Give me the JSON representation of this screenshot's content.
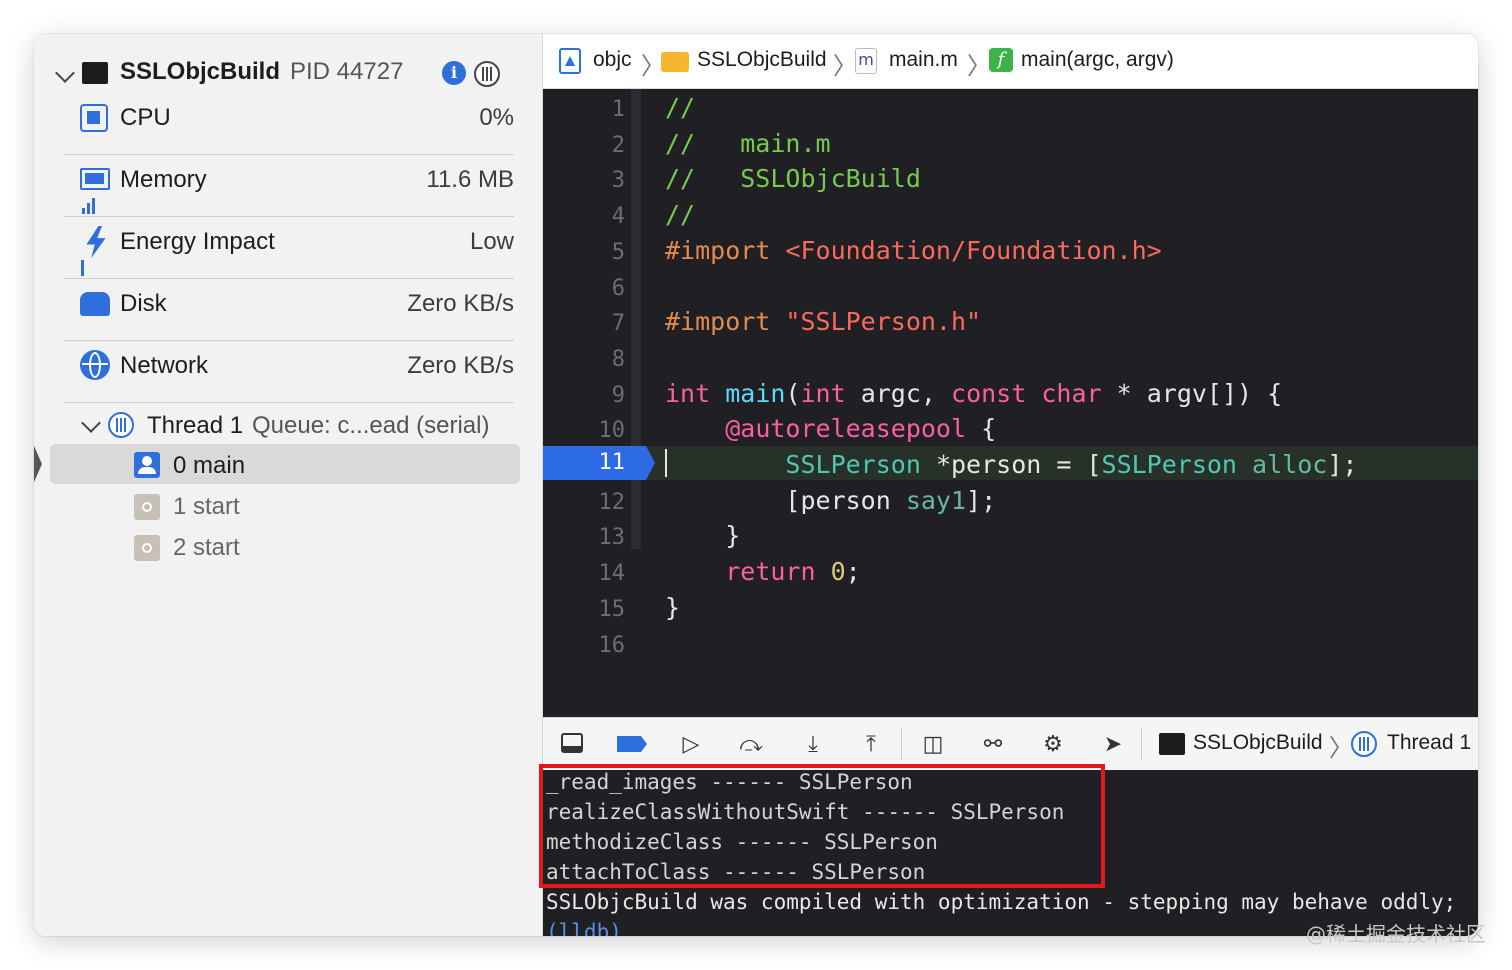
{
  "process": {
    "name": "SSLObjcBuild",
    "pid": "PID 44727"
  },
  "gauges": [
    {
      "label": "CPU",
      "value": "0%"
    },
    {
      "label": "Memory",
      "value": "11.6 MB"
    },
    {
      "label": "Energy Impact",
      "value": "Low"
    },
    {
      "label": "Disk",
      "value": "Zero KB/s"
    },
    {
      "label": "Network",
      "value": "Zero KB/s"
    }
  ],
  "thread": {
    "name": "Thread 1",
    "queue": "Queue: c...ead (serial)"
  },
  "frames": [
    {
      "label": "0 main"
    },
    {
      "label": "1 start"
    },
    {
      "label": "2 start"
    }
  ],
  "jump_bar": [
    "objc",
    "SSLObjcBuild",
    "main.m",
    "main(argc, argv)"
  ],
  "jump_icons": {
    "file": "m",
    "func": "f"
  },
  "code": {
    "line_numbers": [
      "1",
      "2",
      "3",
      "4",
      "5",
      "6",
      "7",
      "8",
      "9",
      "10",
      "11",
      "12",
      "13",
      "14",
      "15",
      "16"
    ],
    "breakpoint_line": "11",
    "lines": [
      [
        "//"
      ],
      [
        "//   main.m"
      ],
      [
        "//   SSLObjcBuild"
      ],
      [
        "//"
      ],
      [
        "#import ",
        "<Foundation/Foundation.h>"
      ],
      [
        ""
      ],
      [
        "#import ",
        "\"SSLPerson.h\""
      ],
      [
        ""
      ],
      [
        "int",
        " ",
        "main",
        "(",
        "int",
        " argc, ",
        "const",
        " ",
        "char",
        " * argv[]) {"
      ],
      [
        "    ",
        "@autoreleasepool",
        " {"
      ],
      [
        "        ",
        "SSLPerson",
        " *person = [",
        "SSLPerson",
        " ",
        "alloc",
        "];"
      ],
      [
        "        [person ",
        "say1",
        "];"
      ],
      [
        "    }"
      ],
      [
        "    ",
        "return",
        " ",
        "0",
        ";"
      ],
      [
        "}"
      ],
      [
        ""
      ]
    ]
  },
  "debug_bar": {
    "process": "SSLObjcBuild",
    "thread": "Thread 1"
  },
  "console": [
    "_read_images ------ SSLPerson",
    "realizeClassWithoutSwift ------ SSLPerson",
    "methodizeClass ------ SSLPerson",
    "attachToClass ------ SSLPerson",
    "SSLObjcBuild was compiled with optimization - stepping may behave oddly;",
    "(lldb)"
  ],
  "watermark": "@稀土掘金技术社区",
  "colors": {
    "breakpoint": "#2c6ae6",
    "highlight_box": "#e0191a",
    "editor_bg": "#1f1f24"
  }
}
